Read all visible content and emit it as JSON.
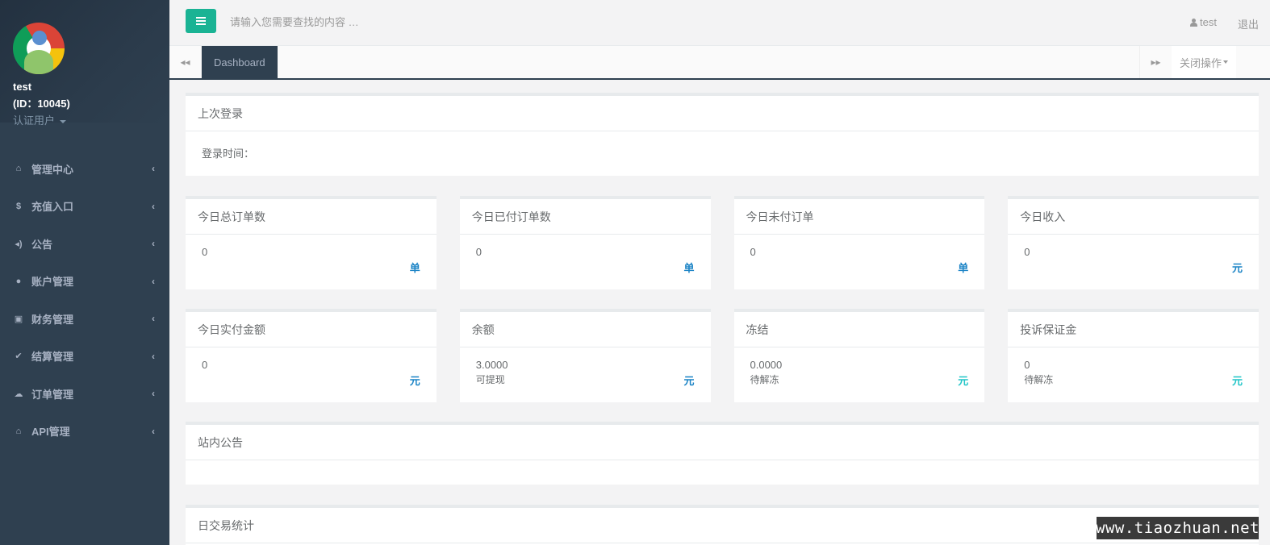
{
  "profile": {
    "username": "test",
    "id_line": "(ID：10045)",
    "role": "认证用户"
  },
  "sidebar": {
    "items": [
      {
        "label": "管理中心",
        "icon": "home-icon",
        "glyph": "⌂"
      },
      {
        "label": "充值入口",
        "icon": "dollar-icon",
        "glyph": "$"
      },
      {
        "label": "公告",
        "icon": "volume-icon",
        "glyph": "◂)"
      },
      {
        "label": "账户管理",
        "icon": "user-icon",
        "glyph": "●"
      },
      {
        "label": "财务管理",
        "icon": "money-icon",
        "glyph": "▣"
      },
      {
        "label": "结算管理",
        "icon": "check-icon",
        "glyph": "✔"
      },
      {
        "label": "订单管理",
        "icon": "cloud-icon",
        "glyph": "☁"
      },
      {
        "label": "API管理",
        "icon": "bank-icon",
        "glyph": "⌂"
      }
    ],
    "arrow": "‹"
  },
  "topbar": {
    "search_placeholder": "请输入您需要查找的内容 …",
    "user": "test",
    "logout": "退出"
  },
  "tabs": {
    "active": "Dashboard",
    "close_ops": "关闭操作",
    "prev_glyph": "◂◂",
    "next_glyph": "▸▸"
  },
  "last_login": {
    "title": "上次登录",
    "label": "登录时间："
  },
  "stats_row1": [
    {
      "title": "今日总订单数",
      "value": "0",
      "unit": "单"
    },
    {
      "title": "今日已付订单数",
      "value": "0",
      "unit": "单"
    },
    {
      "title": "今日未付订单",
      "value": "0",
      "unit": "单"
    },
    {
      "title": "今日收入",
      "value": "0",
      "unit": "元"
    }
  ],
  "stats_row2": [
    {
      "title": "今日实付金额",
      "value": "0",
      "sub": "",
      "unit": "元"
    },
    {
      "title": "余额",
      "value": "3.0000",
      "sub": "可提现",
      "unit": "元"
    },
    {
      "title": "冻结",
      "value": "0.0000",
      "sub": "待解冻",
      "unit": "元"
    },
    {
      "title": "投诉保证金",
      "value": "0",
      "sub": "待解冻",
      "unit": "元"
    }
  ],
  "notice": {
    "title": "站内公告"
  },
  "trade_stats": {
    "title": "日交易统计"
  },
  "watermark": "www.tiaozhuan.net",
  "colors": {
    "sidebar_bg": "#2f4050",
    "accent": "#1ab394",
    "unit_blue": "#1c84c6",
    "unit_cyan": "#23c6c8"
  }
}
